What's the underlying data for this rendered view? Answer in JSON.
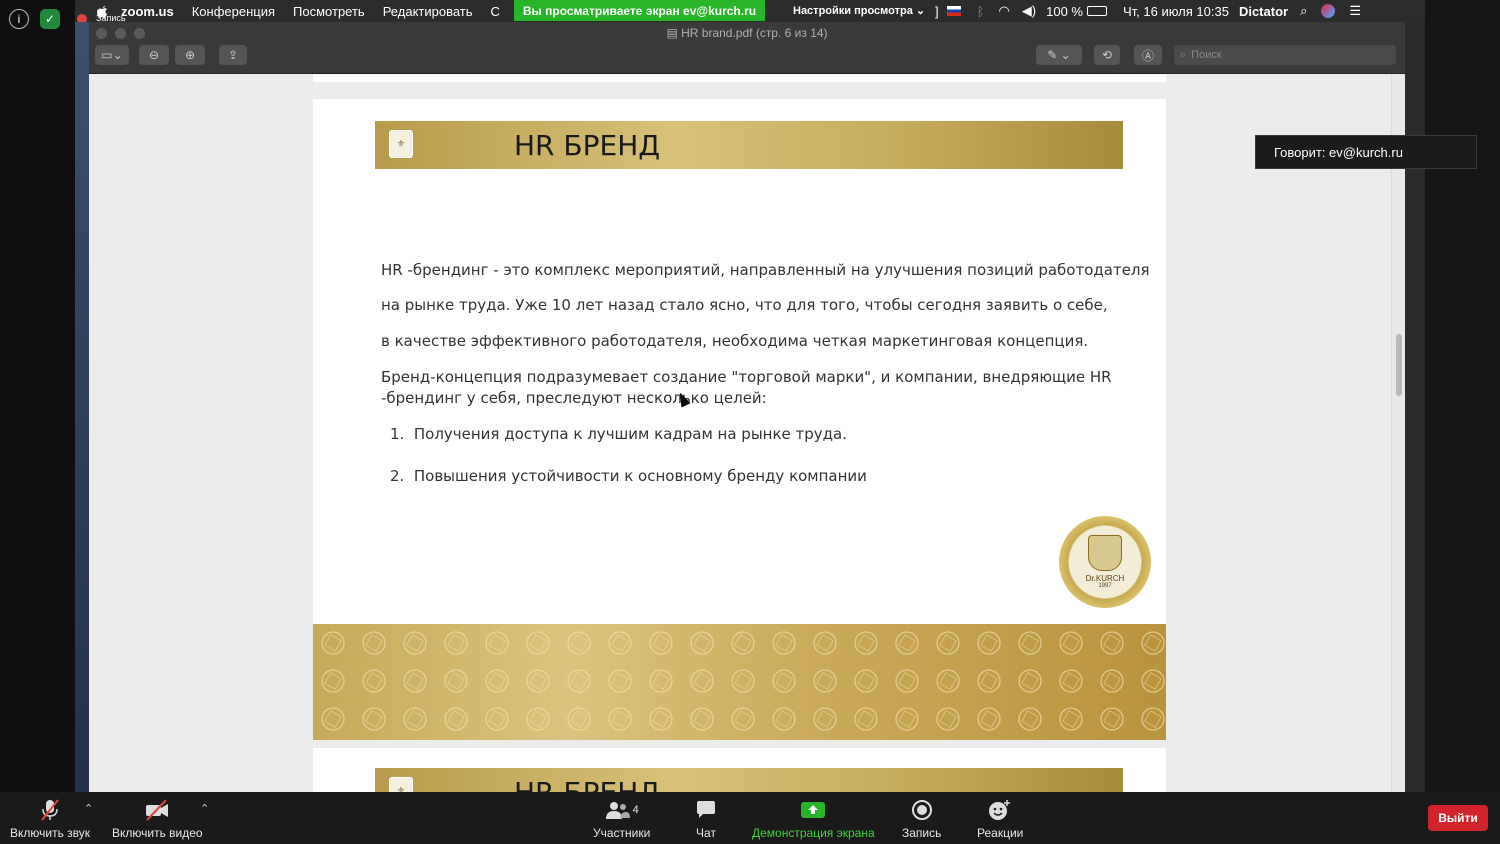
{
  "menubar": {
    "app_name": "zoom.us",
    "menus": [
      "Конференция",
      "Посмотреть",
      "Редактировать",
      "С"
    ],
    "recording_label": "Запись",
    "viewing_banner": "Вы просматриваете экран ev@kurch.ru",
    "view_settings": "Настройки просмотра",
    "battery": "100 %",
    "datetime": "Чт, 16 июля  10:35",
    "user": "Dictator"
  },
  "preview": {
    "doc_title": "HR brand.pdf (стр. 6 из 14)",
    "search_placeholder": "Поиск"
  },
  "page": {
    "header_title": "HR БРЕНД",
    "paragraph_lines": [
      "HR -брендинг - это комплекс мероприятий, направленный на улучшения позиций работодателя",
      "на рынке труда. Уже 10 лет назад стало ясно, что для того, чтобы сегодня заявить о себе,",
      "в качестве эффективного работодателя, необходима четкая маркетинговая концепция.",
      "Бренд-концепция подразумевает создание \"торговой марки\", и компании, внедряющие HR",
      "-брендинг  у себя, преследуют несколько целей:"
    ],
    "list_items": [
      {
        "num": "1.",
        "text": "Получения доступа к лучшим кадрам на рынке труда."
      },
      {
        "num": "2.",
        "text": "Повышения устойчивости к основному бренду компании"
      }
    ],
    "seal_text": "Dr.KURCH",
    "seal_year": "1997",
    "next_page_title": "HR БРЕНД"
  },
  "speaker_tooltip": "Говорит: ev@kurch.ru",
  "zoom_toolbar": {
    "audio_label": "Включить звук",
    "video_label": "Включить видео",
    "participants_label": "Участники",
    "participants_count": "4",
    "chat_label": "Чат",
    "share_label": "Демонстрация экрана",
    "record_label": "Запись",
    "reactions_label": "Реакции",
    "exit_label": "Выйти"
  },
  "colors": {
    "share_green": "#28b528",
    "exit_red": "#d1232a",
    "gold": "#c8a95a"
  }
}
